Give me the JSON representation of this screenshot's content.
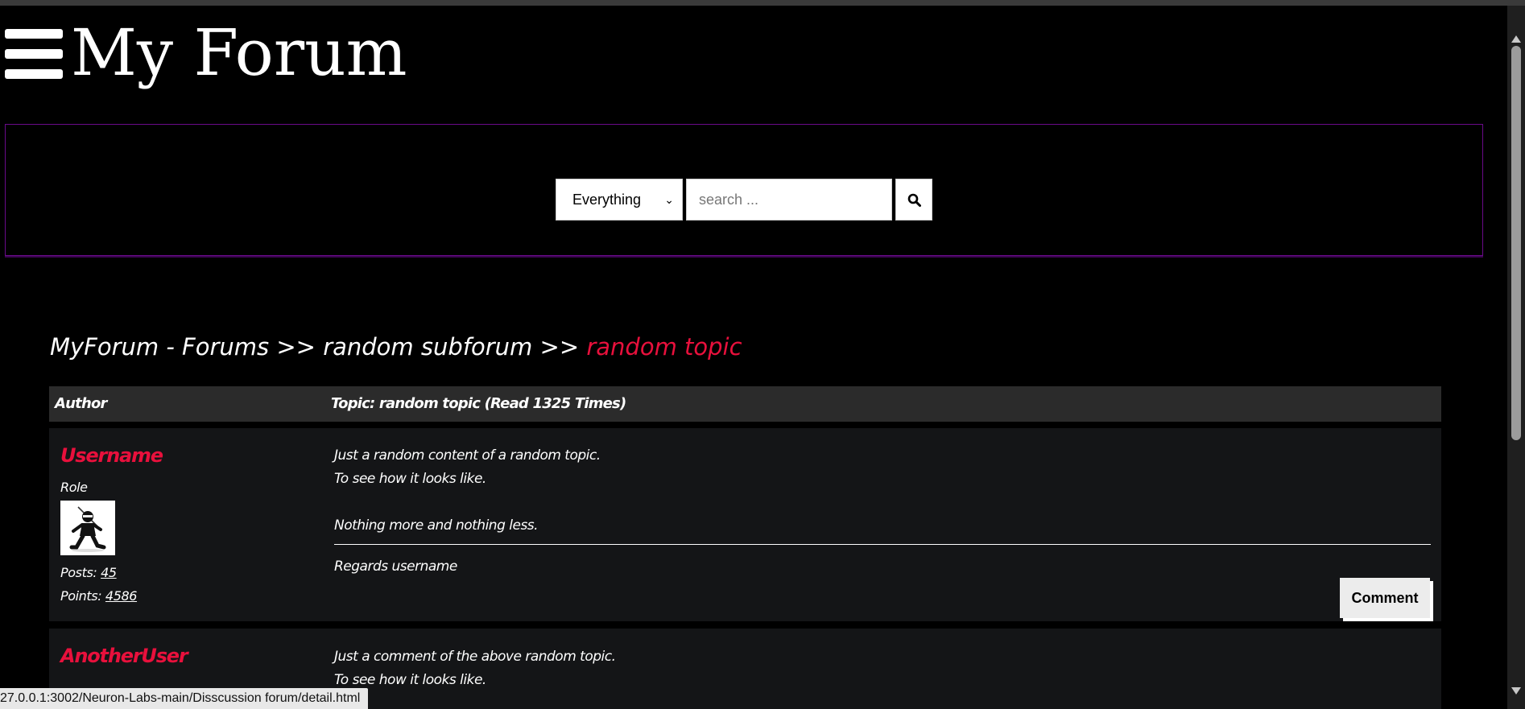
{
  "header": {
    "site_title": "My Forum",
    "menu_icon": "hamburger-menu-icon"
  },
  "search": {
    "scope_selected": "Everything",
    "placeholder": "search ...",
    "button_icon": "search-icon"
  },
  "breadcrumb": {
    "root": "MyForum - Forums",
    "separator": ">>",
    "subforum": "random subforum",
    "current": "random topic"
  },
  "table": {
    "col_author": "Author",
    "col_topic": "Topic: random topic (Read 1325 Times)"
  },
  "posts": [
    {
      "author": "Username",
      "role": "Role",
      "avatar_icon": "ninja-avatar-icon",
      "posts_label": "Posts:",
      "posts_count": "45",
      "points_label": "Points:",
      "points_count": "4586",
      "lines": [
        "Just a random content of a random topic.",
        "To see how it looks like.",
        "Nothing more and nothing less."
      ],
      "signature": "Regards username",
      "comment_label": "Comment"
    },
    {
      "author": "AnotherUser",
      "lines": [
        "Just a comment of the above random topic.",
        "To see how it looks like."
      ]
    }
  ],
  "status_bar": {
    "url": "27.0.0.1:3002/Neuron-Labs-main/Disscussion forum/detail.html"
  },
  "colors": {
    "accent_red": "#e8103c",
    "panel_border": "#6a0a8a",
    "post_bg": "#141517",
    "header_row_bg": "#2b2b2b"
  }
}
